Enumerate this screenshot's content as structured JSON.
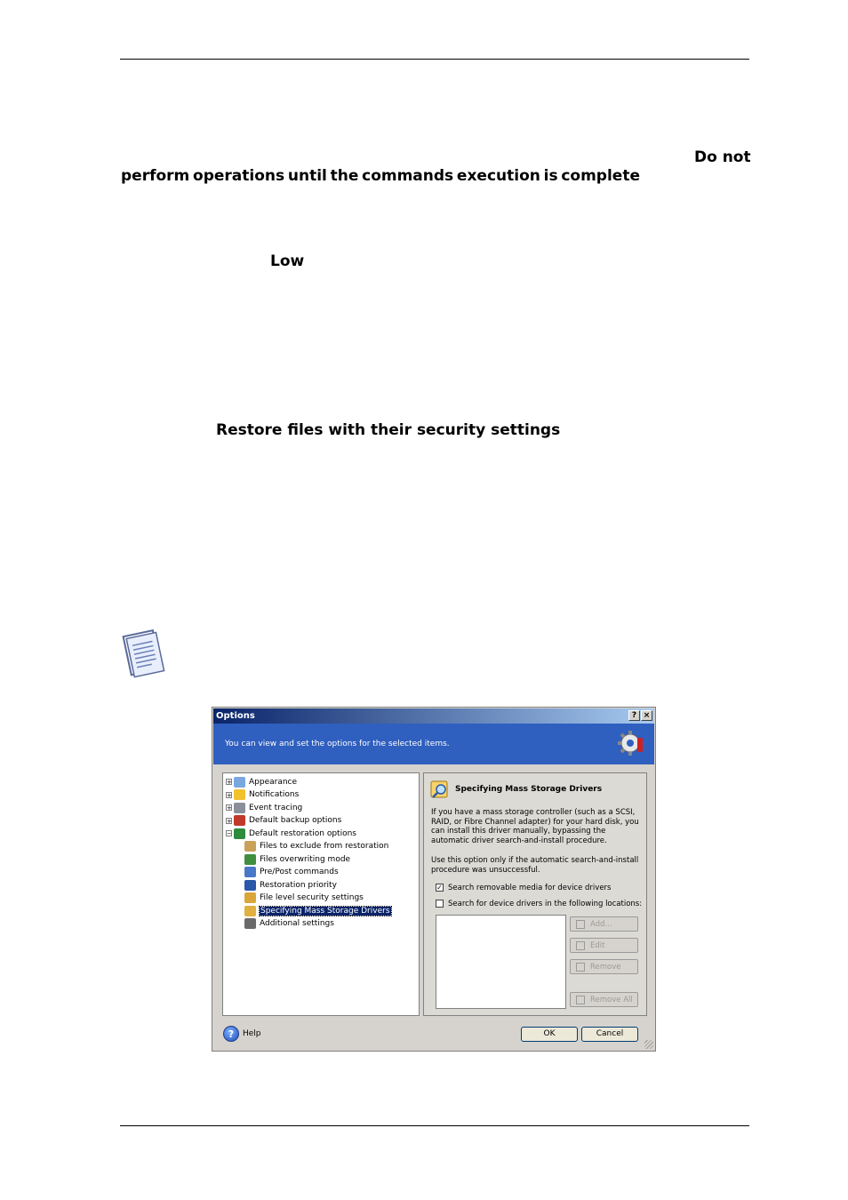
{
  "document": {
    "line1_bold": "Do not",
    "line2_words": [
      "perform",
      "operations",
      "until",
      "the",
      "commands",
      "execution",
      "is",
      "complete"
    ],
    "priority_low": "Low",
    "restore_security": "Restore files with their security settings"
  },
  "dialog": {
    "title": "Options",
    "help_q": "?",
    "close_x": "×",
    "banner_text": "You can view and set the options for the selected items.",
    "tree": [
      {
        "label": "Appearance",
        "expander": "+",
        "icon_color": "#7aa7e0"
      },
      {
        "label": "Notifications",
        "expander": "+",
        "icon_color": "#f2c12e"
      },
      {
        "label": "Event tracing",
        "expander": "+",
        "icon_color": "#8a8f9a"
      },
      {
        "label": "Default backup options",
        "expander": "+",
        "icon_color": "#c0392b"
      },
      {
        "label": "Default restoration options",
        "expander": "−",
        "icon_color": "#2e8b3e"
      },
      {
        "label": "Files to exclude from restoration",
        "icon_color": "#c9a15a"
      },
      {
        "label": "Files overwriting mode",
        "icon_color": "#3f8f3f"
      },
      {
        "label": "Pre/Post commands",
        "icon_color": "#4a78c8"
      },
      {
        "label": "Restoration priority",
        "icon_color": "#2b57a8"
      },
      {
        "label": "File level security settings",
        "icon_color": "#d9a63a"
      },
      {
        "label": "Specifying Mass Storage Drivers",
        "icon_color": "#e0b040",
        "selected": true
      },
      {
        "label": "Additional settings",
        "icon_color": "#6a6a6a"
      }
    ],
    "panel": {
      "title": "Specifying Mass Storage Drivers",
      "paragraph1": "If you have a mass storage controller (such as a SCSI, RAID, or Fibre Channel adapter) for your hard disk, you can install this driver manually, bypassing the automatic driver search-and-install procedure.",
      "paragraph2": "Use this option only if the automatic search-and-install procedure was unsuccessful.",
      "checkbox1": {
        "label": "Search removable media for device drivers",
        "checked": true
      },
      "checkbox2": {
        "label": "Search for device drivers in the following locations:",
        "checked": false
      },
      "buttons": [
        "Add...",
        "Edit",
        "Remove",
        "Remove All"
      ]
    },
    "help_label": "Help",
    "ok_label": "OK",
    "cancel_label": "Cancel"
  }
}
